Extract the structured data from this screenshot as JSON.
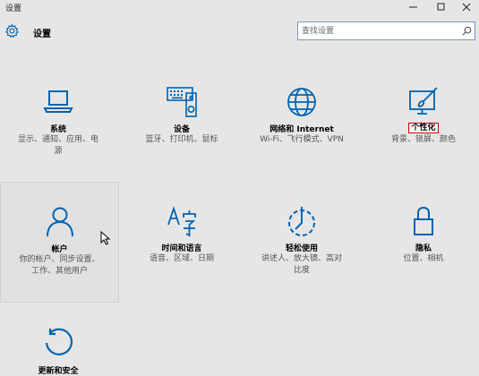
{
  "window": {
    "title": "设置"
  },
  "header": {
    "title": "设置"
  },
  "search": {
    "placeholder": "查找设置"
  },
  "colors": {
    "accent": "#0063b1",
    "highlight_border": "#d80000"
  },
  "tiles": [
    {
      "icon": "monitor-icon",
      "title": "系统",
      "desc_lines": [
        "显示、通知、应用、电",
        "源"
      ]
    },
    {
      "icon": "keyboard-device-icon",
      "title": "设备",
      "desc_lines": [
        "蓝牙、打印机、鼠标"
      ]
    },
    {
      "icon": "globe-icon",
      "title": "网络和 Internet",
      "desc_lines": [
        "Wi-Fi、飞行模式、VPN"
      ]
    },
    {
      "icon": "paint-monitor-icon",
      "title": "个性化",
      "desc_lines": [
        "背景、锁屏、颜色"
      ],
      "highlighted": true
    },
    {
      "icon": "person-icon",
      "title": "帐户",
      "desc_lines": [
        "你的帐户、同步设置、",
        "工作、其他用户"
      ],
      "hovered": true
    },
    {
      "icon": "time-language-icon",
      "title": "时间和语言",
      "desc_lines": [
        "语音、区域、日期"
      ]
    },
    {
      "icon": "ease-of-access-icon",
      "title": "轻松使用",
      "desc_lines": [
        "讲述人、放大镜、高对",
        "比度"
      ]
    },
    {
      "icon": "lock-icon",
      "title": "隐私",
      "desc_lines": [
        "位置、相机"
      ]
    },
    {
      "icon": "update-arrow-icon",
      "title": "更新和安全",
      "desc_lines": []
    }
  ]
}
